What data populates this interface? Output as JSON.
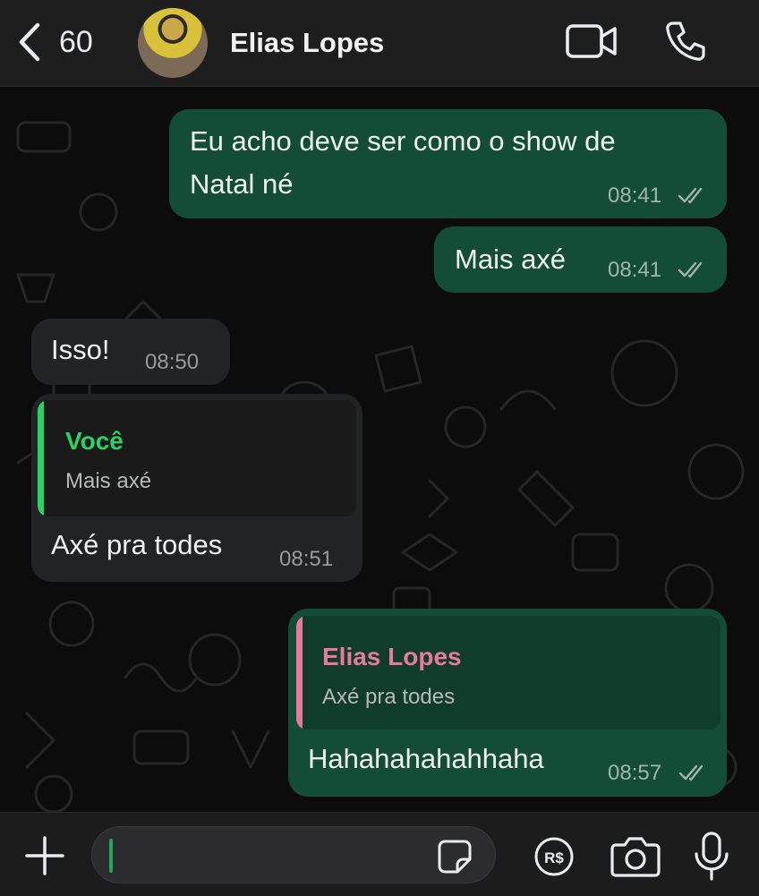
{
  "header": {
    "back_count": "60",
    "contact_name": "Elias Lopes"
  },
  "messages": [
    {
      "direction": "out",
      "text_line1": "Eu acho deve ser como o show de",
      "text_line2": "Natal né",
      "time": "08:41",
      "status": "read"
    },
    {
      "direction": "out",
      "text": "Mais axé",
      "time": "08:41",
      "status": "read"
    },
    {
      "direction": "in",
      "text": "Isso!",
      "time": "08:50"
    },
    {
      "direction": "in",
      "quote_author": "Você",
      "quote_text": "Mais axé",
      "text": "Axé pra todes",
      "time": "08:51"
    },
    {
      "direction": "out",
      "quote_author": "Elias Lopes",
      "quote_text": "Axé pra todes",
      "text": "Hahahahahahhaha",
      "time": "08:57",
      "status": "read"
    }
  ],
  "colors": {
    "outgoing_bubble": "#144d37",
    "incoming_bubble": "#222325",
    "quote_you": "#25d366",
    "quote_contact": "#e87a9f"
  },
  "input": {
    "placeholder": "",
    "icons": [
      "plus-icon",
      "sticker-icon",
      "pix-payment-icon",
      "camera-icon",
      "microphone-icon"
    ]
  }
}
